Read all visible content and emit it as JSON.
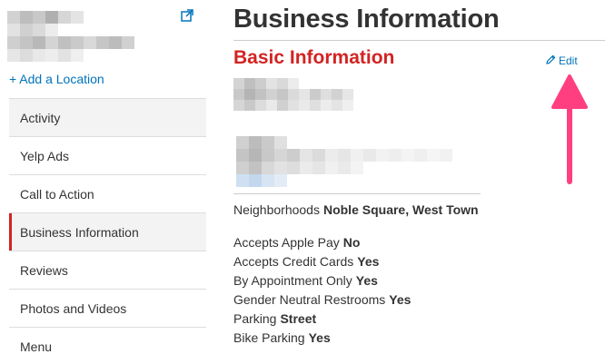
{
  "sidebar": {
    "add_location": "+ Add a Location",
    "items": [
      {
        "label": "Activity"
      },
      {
        "label": "Yelp Ads"
      },
      {
        "label": "Call to Action"
      },
      {
        "label": "Business Information"
      },
      {
        "label": "Reviews"
      },
      {
        "label": "Photos and Videos"
      },
      {
        "label": "Menu"
      }
    ],
    "active_item": "Business Information"
  },
  "main": {
    "page_title": "Business Information",
    "section_title": "Basic Information",
    "edit_label": "Edit",
    "fields": [
      {
        "label": "Neighborhoods",
        "value": "Noble Square, West Town"
      },
      {
        "label": "Accepts Apple Pay",
        "value": "No"
      },
      {
        "label": "Accepts Credit Cards",
        "value": "Yes"
      },
      {
        "label": "By Appointment Only",
        "value": "Yes"
      },
      {
        "label": "Gender Neutral Restrooms",
        "value": "Yes"
      },
      {
        "label": "Parking",
        "value": "Street"
      },
      {
        "label": "Bike Parking",
        "value": "Yes"
      }
    ]
  },
  "colors": {
    "accent_red": "#d32323",
    "link_blue": "#0073bb",
    "annotation_arrow": "#ff3f7f"
  },
  "icons": [
    "external-link-icon",
    "pencil-icon",
    "annotation-arrow"
  ]
}
